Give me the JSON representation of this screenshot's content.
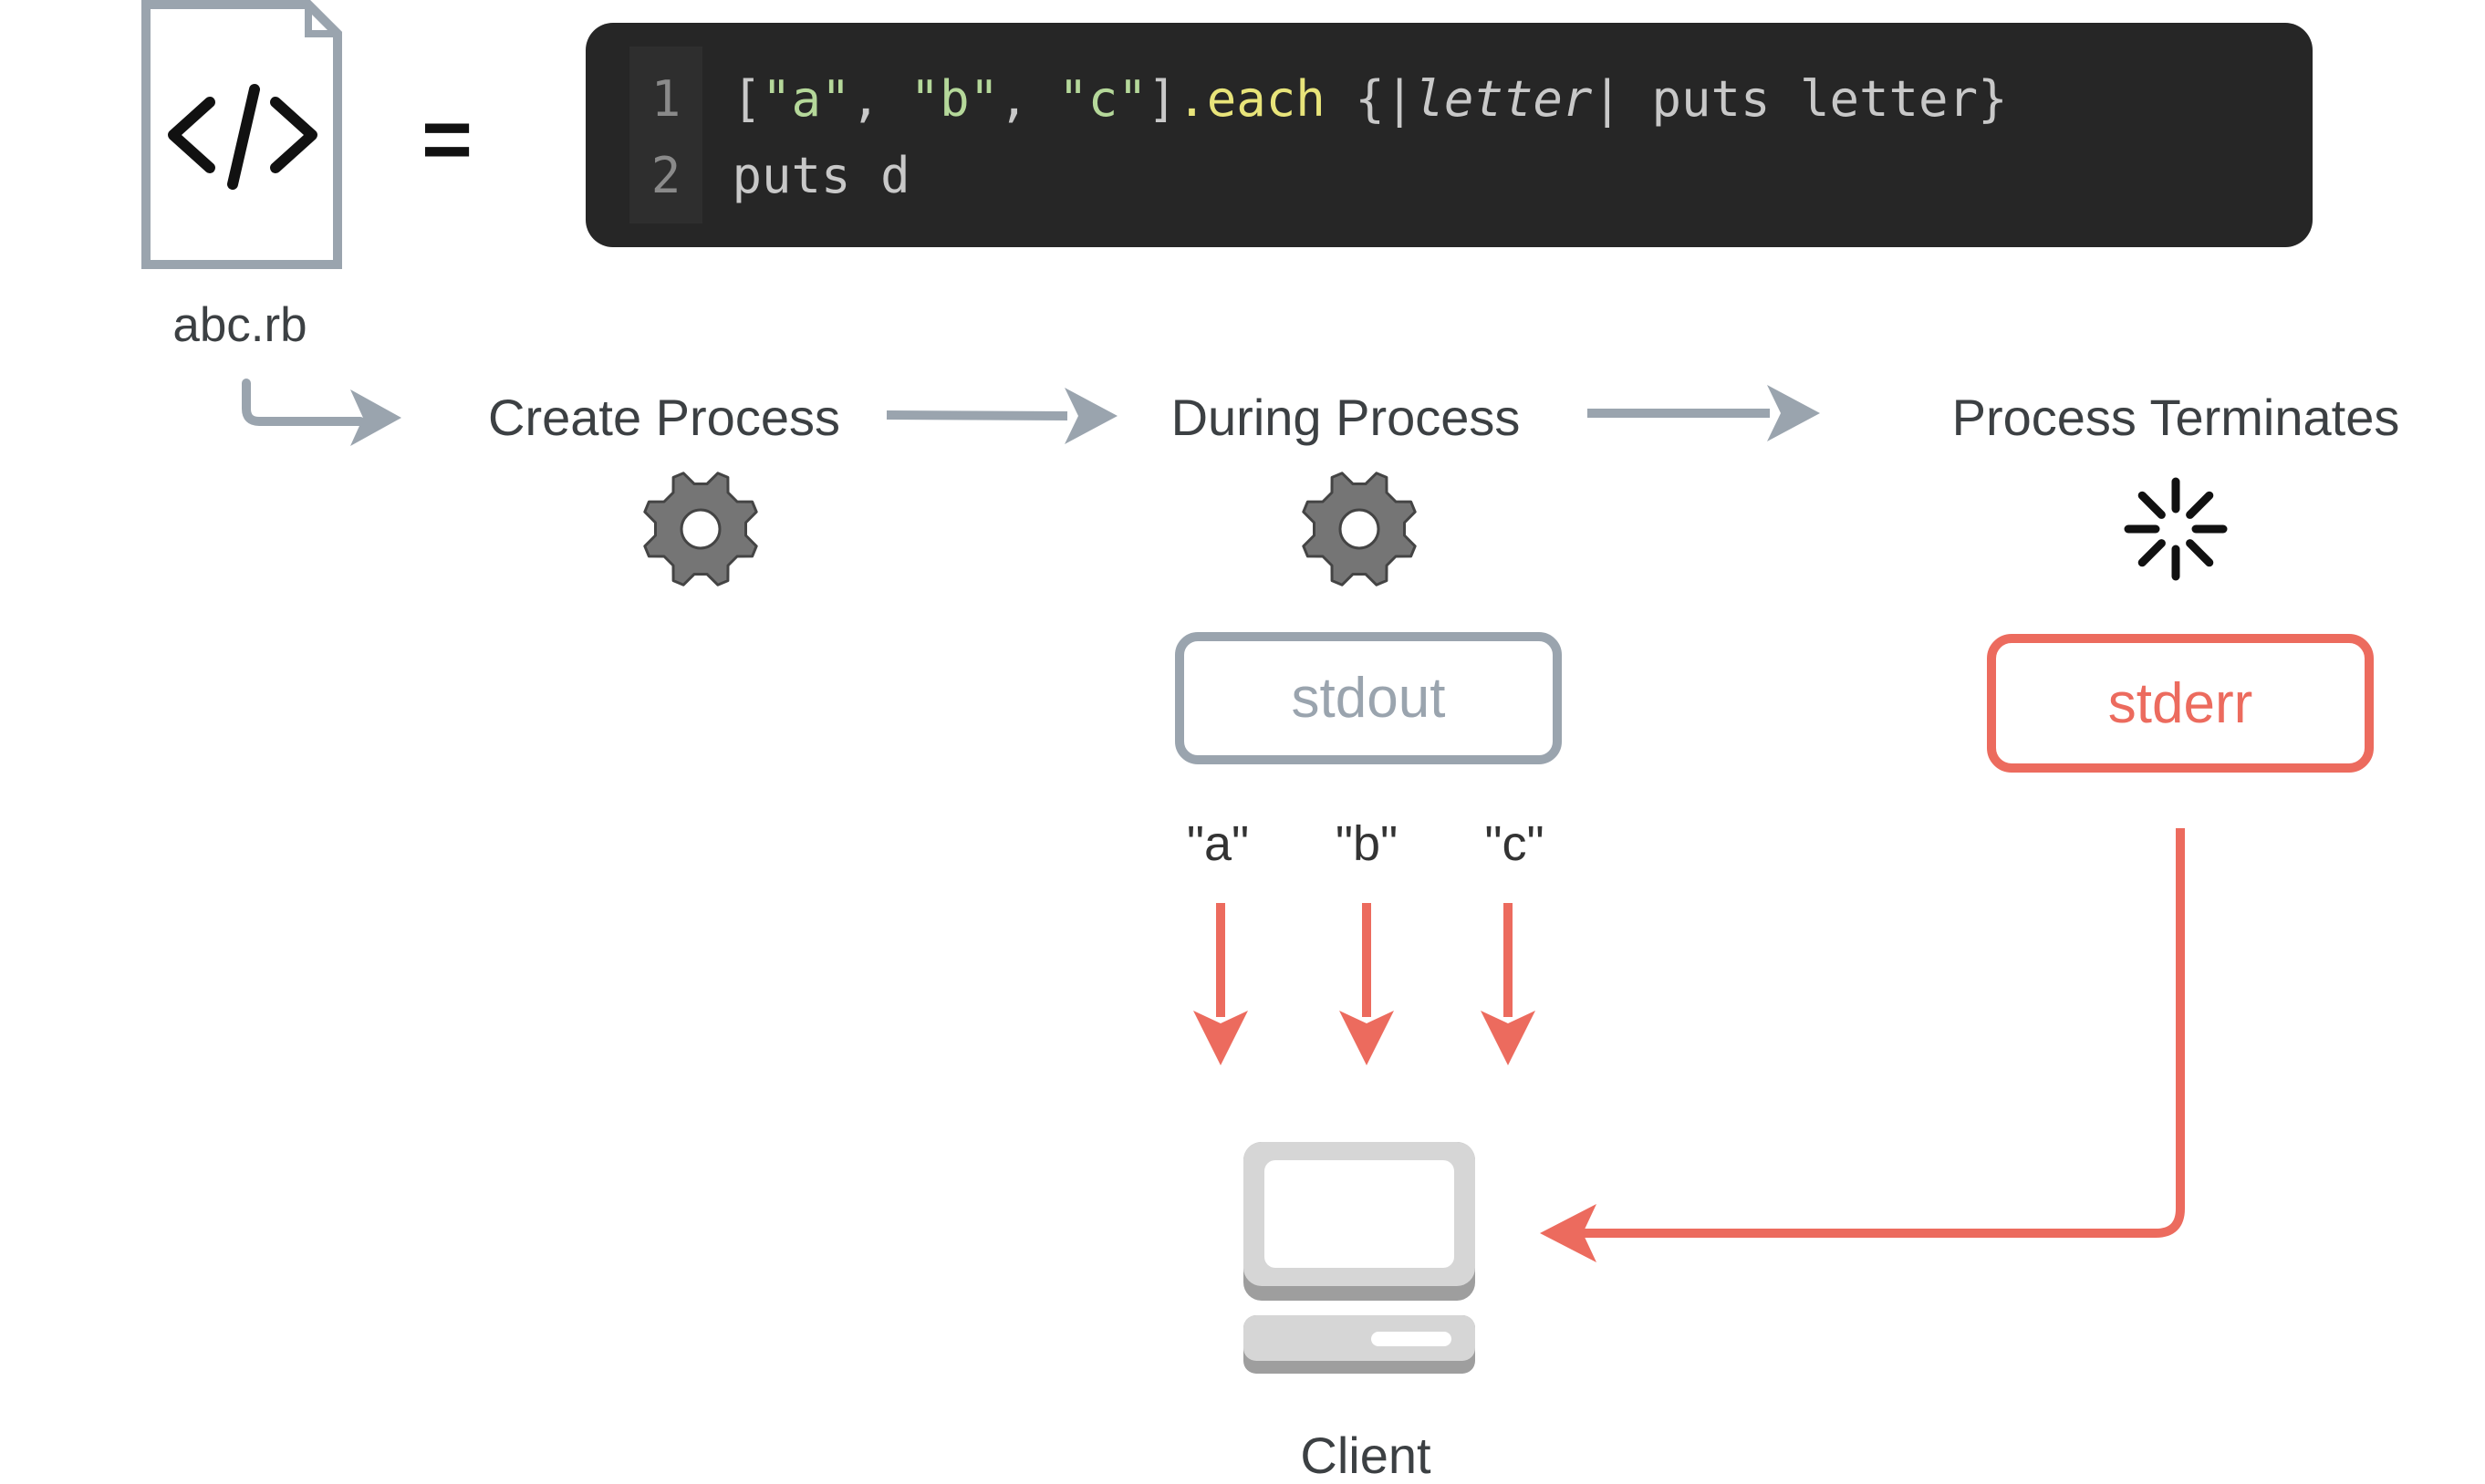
{
  "file": {
    "name": "abc.rb",
    "icon": "code-file-icon",
    "equals_sign": "="
  },
  "code": {
    "lines": [
      {
        "number": "1",
        "tokens": [
          {
            "text": "[",
            "kind": "plain"
          },
          {
            "text": "\"a\"",
            "kind": "str"
          },
          {
            "text": ", ",
            "kind": "plain"
          },
          {
            "text": "\"b\"",
            "kind": "str"
          },
          {
            "text": ", ",
            "kind": "plain"
          },
          {
            "text": "\"c\"",
            "kind": "str"
          },
          {
            "text": "]",
            "kind": "plain"
          },
          {
            "text": ".each",
            "kind": "method"
          },
          {
            "text": " {|",
            "kind": "plain"
          },
          {
            "text": "letter",
            "kind": "param"
          },
          {
            "text": "| puts letter}",
            "kind": "plain"
          }
        ]
      },
      {
        "number": "2",
        "tokens": [
          {
            "text": "puts d",
            "kind": "plain"
          }
        ]
      }
    ]
  },
  "steps": {
    "create": "Create Process",
    "during": "During Process",
    "terminates": "Process Terminates"
  },
  "streams": {
    "stdout": "stdout",
    "stderr": "stderr",
    "outputs": [
      "\"a\"",
      "\"b\"",
      "\"c\""
    ]
  },
  "client": {
    "label": "Client",
    "icon": "computer-icon"
  },
  "icons": {
    "process_running": "gear-icon",
    "process_terminated": "burst-icon"
  },
  "colors": {
    "grey_line": "#9aa4ae",
    "error_red": "#ec6b5e",
    "code_bg": "#262626",
    "gear": "#757575"
  }
}
